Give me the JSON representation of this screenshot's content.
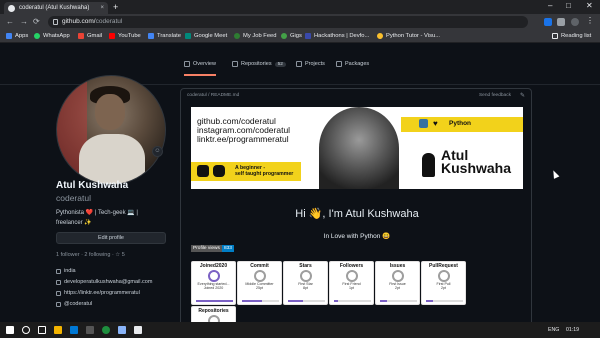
{
  "browser": {
    "tab_title": "coderatul (Atul Kushwaha)",
    "tab_close": "×",
    "new_tab": "+",
    "url_host": "github.com/",
    "url_path": "coderatul",
    "window_controls": [
      "–",
      "□",
      "✕"
    ],
    "nav": [
      "←",
      "→",
      "⟳"
    ]
  },
  "bookmarks": [
    {
      "label": "Apps",
      "color": "#4285f4"
    },
    {
      "label": "WhatsApp",
      "color": "#25d366"
    },
    {
      "label": "Gmail",
      "color": "#ea4335"
    },
    {
      "label": "YouTube",
      "color": "#ff0000"
    },
    {
      "label": "Translate",
      "color": "#4285f4"
    },
    {
      "label": "Google Meet",
      "color": "#00897b"
    },
    {
      "label": "My Job Feed",
      "color": "#2e7d32"
    },
    {
      "label": "Gigs",
      "color": "#43a047"
    },
    {
      "label": "Hackathons | Devfo...",
      "color": "#3949ab"
    },
    {
      "label": "Python Tutor - Visu...",
      "color": "#fbc02d"
    }
  ],
  "reading_list": "Reading list",
  "github": {
    "tabs": [
      {
        "label": "Overview",
        "count": ""
      },
      {
        "label": "Repositories",
        "count": "52"
      },
      {
        "label": "Projects",
        "count": ""
      },
      {
        "label": "Packages",
        "count": ""
      }
    ]
  },
  "profile": {
    "name": "Atul Kushwaha",
    "username": "coderatul",
    "bio_line1": "Pythonista ❤️ | Tech-geek 💻 |",
    "bio_line2": "freelancer ✨",
    "edit_label": "Edit profile",
    "follow": "1 follower · 2 following · ☆ 5",
    "location": "india",
    "email": "developeratulkushwaha@gmail.com",
    "link": "https://linktr.ee/programmeratul",
    "twitter": "@coderatul",
    "emoji_btn": "☺"
  },
  "readme": {
    "path": "coderatul / README.md",
    "send_feedback": "Send feedback",
    "pencil": "✎",
    "banner": {
      "link1": "github.com/coderatul",
      "link2": "instagram.com/coderatul",
      "link3": "linktr.ee/programmeratul",
      "tagline1": "A beginner -",
      "tagline2": "self taught programmer",
      "python": "Python",
      "heart": "♥",
      "name1": "Atul",
      "name2": "Kushwaha"
    },
    "greeting": "Hi 👋, I'm Atul Kushwaha",
    "love": "In Love with Python 😃",
    "profile_views_label": "Profile views",
    "profile_views_value": "833"
  },
  "trophies": [
    {
      "title": "Joined2020",
      "desc1": "Everything started...",
      "desc2": "Joined 2020",
      "color": "#7b61c4",
      "progress": 1.0
    },
    {
      "title": "Commit",
      "desc1": "Middle Committer",
      "desc2": "25pt",
      "color": "#9e9e9e",
      "progress": 0.55
    },
    {
      "title": "Stars",
      "desc1": "First Star",
      "desc2": "8pt",
      "color": "#9e9e9e",
      "progress": 0.4
    },
    {
      "title": "Followers",
      "desc1": "First Friend",
      "desc2": "1pt",
      "color": "#9e9e9e",
      "progress": 0.1
    },
    {
      "title": "Issues",
      "desc1": "First Issue",
      "desc2": "2pt",
      "color": "#9e9e9e",
      "progress": 0.2
    },
    {
      "title": "PullRequest",
      "desc1": "First Pull",
      "desc2": "2pt",
      "color": "#9e9e9e",
      "progress": 0.2
    },
    {
      "title": "Repositories",
      "desc1": "",
      "desc2": "",
      "color": "#9e9e9e",
      "progress": 0.0
    }
  ],
  "taskbar": {
    "lang": "ENG",
    "time": "01:19"
  }
}
